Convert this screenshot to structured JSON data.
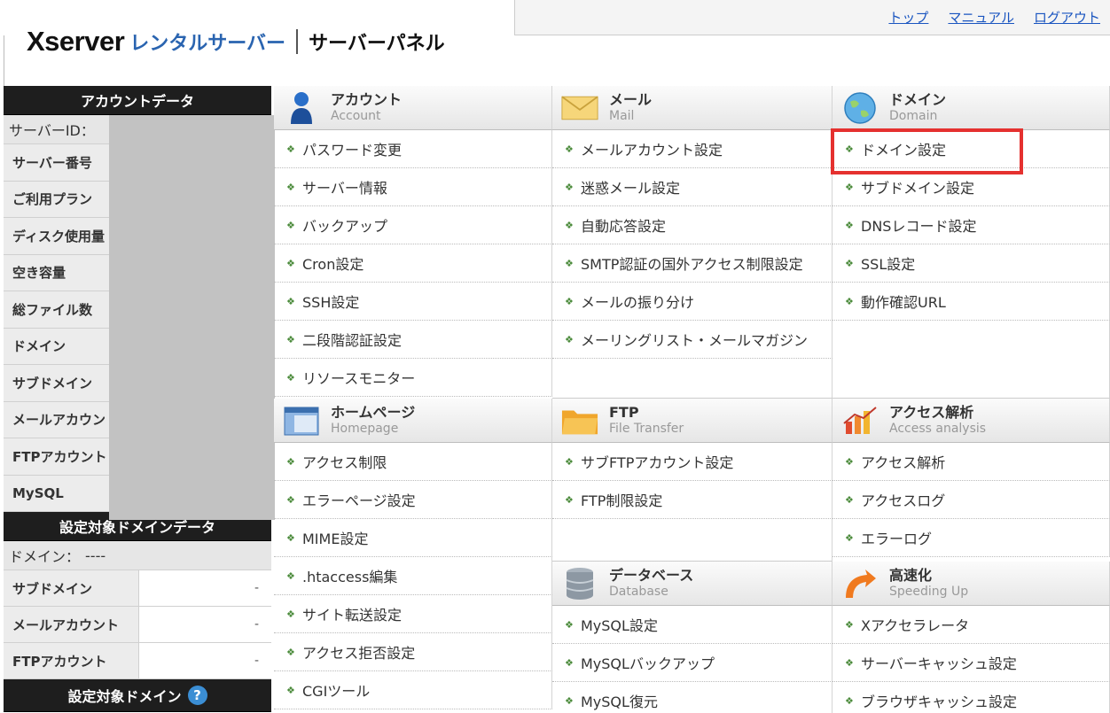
{
  "header": {
    "brand": "Xserver",
    "product": "レンタルサーバー",
    "panel": "サーバーパネル",
    "links": [
      "トップ",
      "マニュアル",
      "ログアウト"
    ]
  },
  "sidebar": {
    "account_title": "アカウントデータ",
    "server_id_label": "サーバーID：",
    "account_rows": [
      "サーバー番号",
      "ご利用プラン",
      "ディスク使用量",
      "空き容量",
      "総ファイル数",
      "ドメイン",
      "サブドメイン",
      "メールアカウント",
      "FTPアカウント",
      "MySQL"
    ],
    "domain_data_title": "設定対象ドメインデータ",
    "domain_label": "ドメイン：",
    "domain_value": "----",
    "domain_rows": [
      {
        "label": "サブドメイン",
        "value": "-"
      },
      {
        "label": "メールアカウント",
        "value": "-"
      },
      {
        "label": "FTPアカウント",
        "value": "-"
      }
    ],
    "target_domain_title": "設定対象ドメイン",
    "help_glyph": "?"
  },
  "sections": {
    "account": {
      "ja": "アカウント",
      "en": "Account",
      "icon": "person-icon",
      "items": [
        "パスワード変更",
        "サーバー情報",
        "バックアップ",
        "Cron設定",
        "SSH設定",
        "二段階認証設定",
        "リソースモニター"
      ]
    },
    "mail": {
      "ja": "メール",
      "en": "Mail",
      "icon": "envelope-icon",
      "items": [
        "メールアカウント設定",
        "迷惑メール設定",
        "自動応答設定",
        "SMTP認証の国外アクセス制限設定",
        "メールの振り分け",
        "メーリングリスト・メールマガジン"
      ]
    },
    "domain": {
      "ja": "ドメイン",
      "en": "Domain",
      "icon": "globe-icon",
      "items": [
        "ドメイン設定",
        "サブドメイン設定",
        "DNSレコード設定",
        "SSL設定",
        "動作確認URL"
      ]
    },
    "homepage": {
      "ja": "ホームページ",
      "en": "Homepage",
      "icon": "window-icon",
      "items": [
        "アクセス制限",
        "エラーページ設定",
        "MIME設定",
        ".htaccess編集",
        "サイト転送設定",
        "アクセス拒否設定",
        "CGIツール"
      ]
    },
    "ftp": {
      "ja": "FTP",
      "en": "File Transfer",
      "icon": "folder-icon",
      "items": [
        "サブFTPアカウント設定",
        "FTP制限設定"
      ]
    },
    "analysis": {
      "ja": "アクセス解析",
      "en": "Access analysis",
      "icon": "chart-icon",
      "items": [
        "アクセス解析",
        "アクセスログ",
        "エラーログ"
      ]
    },
    "database": {
      "ja": "データベース",
      "en": "Database",
      "icon": "database-icon",
      "items": [
        "MySQL設定",
        "MySQLバックアップ",
        "MySQL復元"
      ]
    },
    "speed": {
      "ja": "高速化",
      "en": "Speeding Up",
      "icon": "speed-icon",
      "items": [
        "Xアクセラレータ",
        "サーバーキャッシュ設定",
        "ブラウザキャッシュ設定"
      ]
    }
  },
  "item_arrow": "❖",
  "colors": {
    "accent": "#2a64b0",
    "link": "#1a55c0",
    "highlight": "#e5312f",
    "redaction": "#c2c2c2"
  }
}
